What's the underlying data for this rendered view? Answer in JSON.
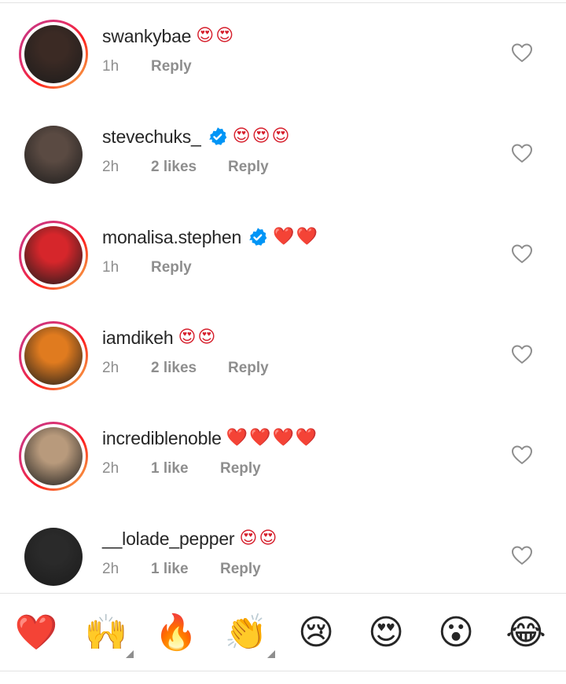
{
  "comments": [
    {
      "username": "swankybae",
      "verified": false,
      "emojis": "😍😍",
      "time": "1h",
      "likes": "",
      "reply": "Reply",
      "story": true,
      "avatar_color": "#3b2a24"
    },
    {
      "username": "stevechuks_",
      "verified": true,
      "emojis": "😍😍😍",
      "time": "2h",
      "likes": "2 likes",
      "reply": "Reply",
      "story": false,
      "avatar_color": "#5a4a42"
    },
    {
      "username": "monalisa.stephen",
      "verified": true,
      "emojis": "❤️❤️",
      "time": "1h",
      "likes": "",
      "reply": "Reply",
      "story": true,
      "avatar_color": "#d6262b"
    },
    {
      "username": "iamdikeh",
      "verified": false,
      "emojis": "😍😍",
      "time": "2h",
      "likes": "2 likes",
      "reply": "Reply",
      "story": true,
      "avatar_color": "#e07b1f"
    },
    {
      "username": "incrediblenoble",
      "verified": false,
      "emojis": "❤️❤️❤️❤️",
      "time": "2h",
      "likes": "1 like",
      "reply": "Reply",
      "story": true,
      "avatar_color": "#b89a7c"
    },
    {
      "username": "__lolade_pepper",
      "verified": false,
      "emojis": "😍😍",
      "time": "2h",
      "likes": "1 like",
      "reply": "Reply",
      "story": false,
      "avatar_color": "#2a2a2a"
    }
  ],
  "reactions": [
    {
      "name": "red-heart",
      "glyph": "❤️"
    },
    {
      "name": "raising-hands",
      "glyph": "🙌"
    },
    {
      "name": "fire",
      "glyph": "🔥"
    },
    {
      "name": "clapping-hands",
      "glyph": "👏"
    },
    {
      "name": "crying-face",
      "glyph": "😢"
    },
    {
      "name": "heart-eyes",
      "glyph": "😍"
    },
    {
      "name": "astonished-face",
      "glyph": "😮"
    },
    {
      "name": "tears-of-joy",
      "glyph": "😂"
    }
  ],
  "colors": {
    "verified_blue": "#0095f6",
    "muted": "#8e8e8e",
    "text": "#262626"
  }
}
